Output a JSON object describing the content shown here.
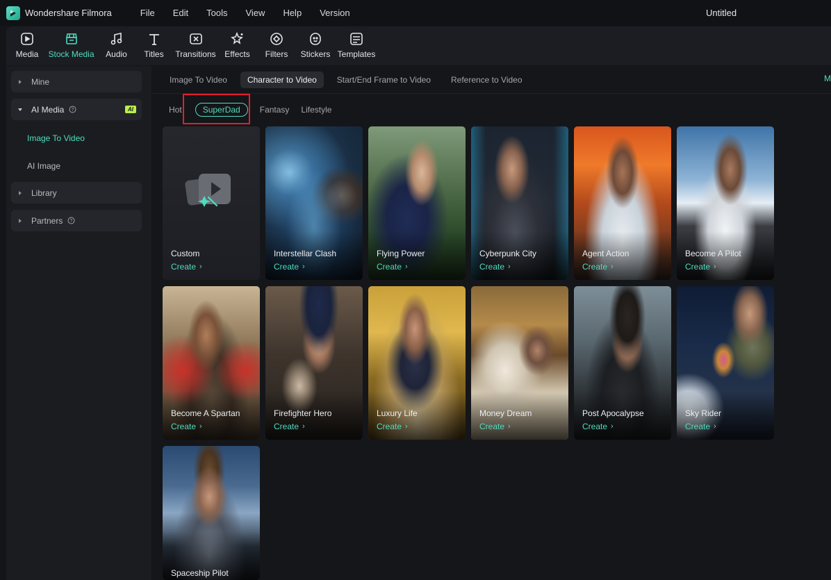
{
  "app": {
    "name": "Wondershare Filmora",
    "window_title": "Untitled"
  },
  "menu": [
    "File",
    "Edit",
    "Tools",
    "View",
    "Help",
    "Version"
  ],
  "toolbar": [
    {
      "label": "Media",
      "icon": "media-icon"
    },
    {
      "label": "Stock Media",
      "icon": "stock-media-icon",
      "active": true
    },
    {
      "label": "Audio",
      "icon": "audio-icon"
    },
    {
      "label": "Titles",
      "icon": "titles-icon"
    },
    {
      "label": "Transitions",
      "icon": "transitions-icon"
    },
    {
      "label": "Effects",
      "icon": "effects-icon"
    },
    {
      "label": "Filters",
      "icon": "filters-icon"
    },
    {
      "label": "Stickers",
      "icon": "stickers-icon"
    },
    {
      "label": "Templates",
      "icon": "templates-icon"
    }
  ],
  "sidebar": {
    "mine": "Mine",
    "ai_media": "AI Media",
    "ai_badge": "AI",
    "image_to_video": "Image To Video",
    "ai_image": "AI Image",
    "library": "Library",
    "partners": "Partners"
  },
  "subtabs": [
    "Image To Video",
    "Character to Video",
    "Start/End Frame to Video",
    "Reference to Video"
  ],
  "subtab_active": "Character to Video",
  "edge_text": "M",
  "categories": [
    "Hot",
    "SuperDad",
    "Fantasy",
    "Lifestyle"
  ],
  "category_active": "SuperDad",
  "create_label": "Create",
  "cards": [
    {
      "title": "Custom"
    },
    {
      "title": "Interstellar Clash"
    },
    {
      "title": "Flying Power"
    },
    {
      "title": "Cyberpunk City"
    },
    {
      "title": "Agent Action"
    },
    {
      "title": "Become A Pilot"
    },
    {
      "title": "Become A Spartan"
    },
    {
      "title": "Firefighter Hero"
    },
    {
      "title": "Luxury Life"
    },
    {
      "title": "Money Dream"
    },
    {
      "title": "Post Apocalypse"
    },
    {
      "title": "Sky Rider"
    },
    {
      "title": "Spaceship Pilot"
    }
  ],
  "colors": {
    "accent": "#4fdcc0",
    "highlight": "#e02030",
    "ai_badge": "#b7f24a"
  }
}
